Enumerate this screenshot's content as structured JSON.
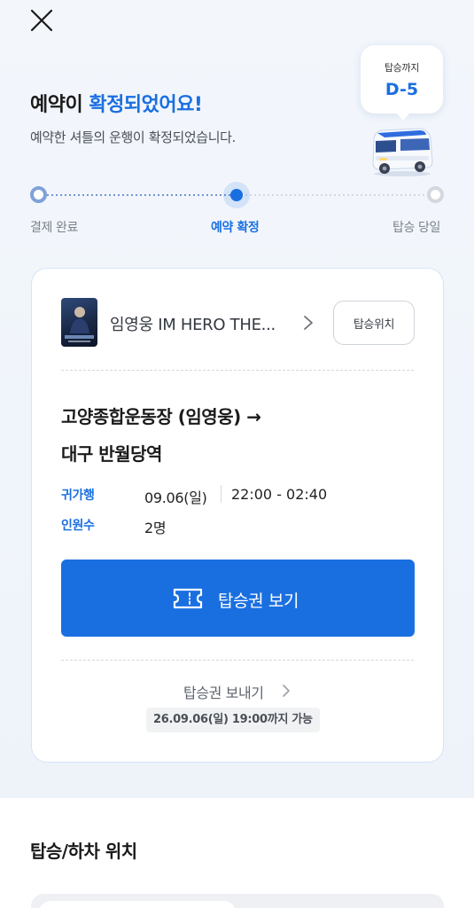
{
  "header": {
    "title_plain": "예약이 ",
    "title_accent": "확정되었어요!",
    "subtitle": "예약한 셔틀의 운행이 확정되었습니다."
  },
  "dday": {
    "label": "탑승까지",
    "value": "D-5"
  },
  "progress": {
    "steps": [
      "결제 완료",
      "예약 확정",
      "탑승 당일"
    ],
    "current_index": 1
  },
  "booking": {
    "event_title": "임영웅 IM HERO THE...",
    "boarding_location_button": "탑승위치",
    "route_from": "고양종합운동장 (임영웅) →",
    "route_to": "대구 반월당역",
    "trip_label": "귀가행",
    "trip_date": "09.06(일)",
    "trip_time": "22:00 - 02:40",
    "passenger_label": "인원수",
    "passenger_count": "2명",
    "view_ticket_button": "탑승권 보기",
    "send_ticket_link": "탑승권 보내기",
    "send_deadline": "26.09.06(일) 19:00까지 가능"
  },
  "location_section": {
    "title": "탑승/하차 위치"
  },
  "colors": {
    "accent": "#1a6fe0",
    "background": "#f3f7fc"
  }
}
